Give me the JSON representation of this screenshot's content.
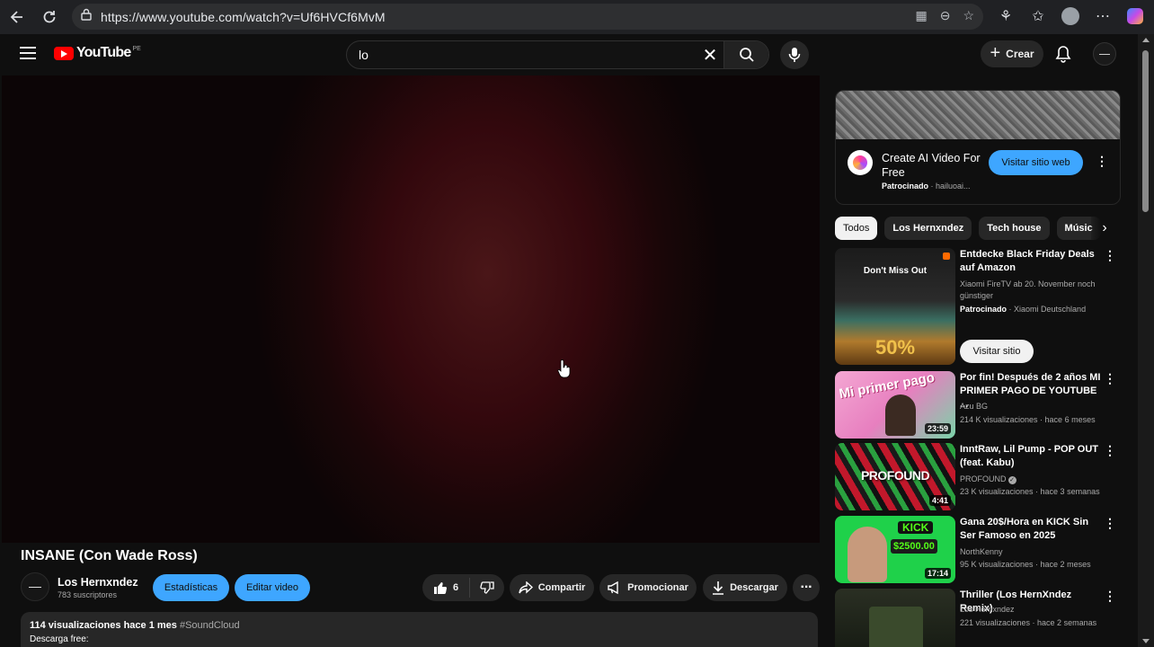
{
  "browser": {
    "url": "https://www.youtube.com/watch?v=Uf6HVCf6MvM"
  },
  "header": {
    "logo_text": "YouTube",
    "logo_country": "PE",
    "search_value": "lo",
    "create_label": "Crear"
  },
  "video": {
    "title": "INSANE (Con Wade Ross)",
    "channel_name": "Los Hernxndez",
    "subscribers": "783 suscriptores",
    "stats_button": "Estadísticas",
    "edit_button": "Editar video",
    "likes": "6",
    "share_label": "Compartir",
    "promote_label": "Promocionar",
    "download_label": "Descargar",
    "views_line": "114 visualizaciones  hace 1 mes",
    "hashtag": "#SoundCloud",
    "desc_line2": "Descarga free:"
  },
  "ad": {
    "title": "Create AI Video For Free",
    "sponsored": "Patrocinado",
    "domain": "· hailuoai...",
    "visit_label": "Visitar sitio web"
  },
  "chips": [
    "Todos",
    "Los Hernxndez",
    "Tech house",
    "Músic"
  ],
  "recommendations": [
    {
      "title": "Entdecke Black Friday Deals auf Amazon",
      "channel": "Xiaomi FireTV ab 20. November noch günstiger",
      "meta_bold": "Patrocinado",
      "meta": "· Xiaomi Deutschland",
      "button": "Visitar sitio",
      "thumb_text": "Don't Miss Out",
      "thumb_sub": "50%"
    },
    {
      "title": "Por fin! Después de 2 años MI PRIMER PAGO DE YOUTUBE ...",
      "channel": "Azu BG",
      "meta": "214 K visualizaciones · hace 6 meses",
      "duration": "23:59",
      "thumb_text": "Mi primer pago"
    },
    {
      "title": "InntRaw, Lil Pump - POP OUT (feat. Kabu)",
      "channel": "PROFOUND",
      "meta": "23 K visualizaciones · hace 3 semanas",
      "duration": "4:41",
      "thumb_text": "PROFOUND"
    },
    {
      "title": "Gana 20$/Hora en KICK Sin Ser Famoso en 2025",
      "channel": "NorthKenny",
      "meta": "95 K visualizaciones · hace 2 meses",
      "duration": "17:14",
      "thumb_text": "KICK",
      "thumb_sub": "$2500.00"
    },
    {
      "title": "Thriller (Los HernXndez Remix)",
      "channel": "Los Hernxndez",
      "meta": "221 visualizaciones · hace 2 semanas"
    }
  ],
  "colors": {
    "accent_blue": "#3ea6ff",
    "brand_red": "#ff0000"
  }
}
